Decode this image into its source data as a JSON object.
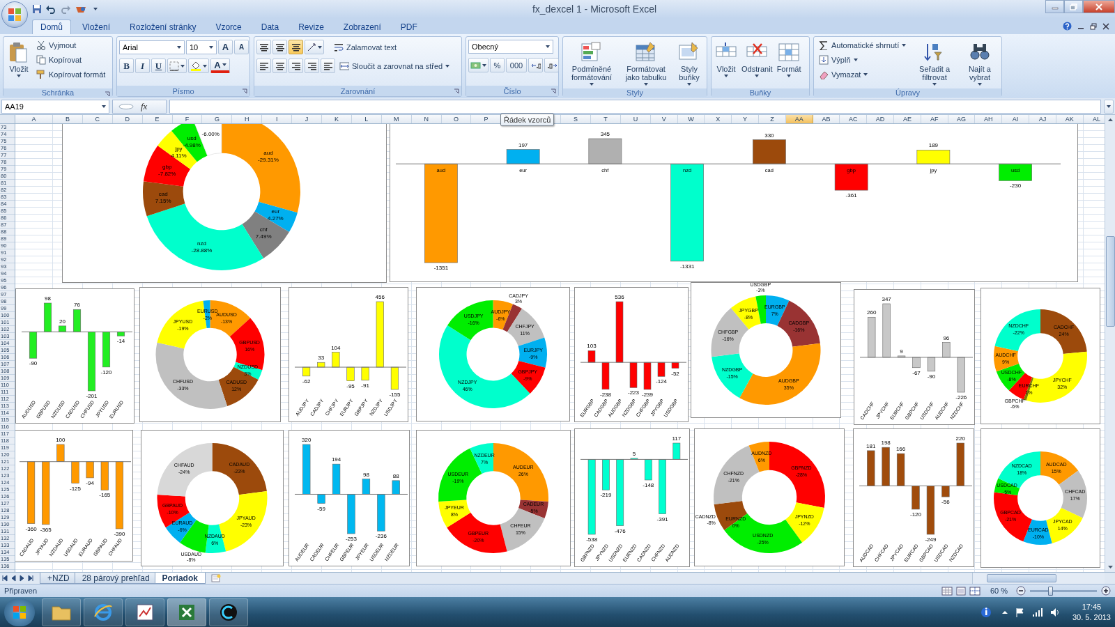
{
  "window": {
    "title": "fx_dexcel 1 - Microsoft Excel"
  },
  "ribbon_tabs": [
    {
      "label": "Domů",
      "selected": true
    },
    {
      "label": "Vložení",
      "selected": false
    },
    {
      "label": "Rozložení stránky",
      "selected": false
    },
    {
      "label": "Vzorce",
      "selected": false
    },
    {
      "label": "Data",
      "selected": false
    },
    {
      "label": "Revize",
      "selected": false
    },
    {
      "label": "Zobrazení",
      "selected": false
    },
    {
      "label": "PDF",
      "selected": false
    }
  ],
  "ribbon": {
    "clipboard": {
      "label": "Schránka",
      "paste": "Vložit",
      "cut": "Vyjmout",
      "copy": "Kopírovat",
      "format_painter": "Kopírovat formát"
    },
    "font": {
      "label": "Písmo",
      "font_name": "Arial",
      "font_size": "10",
      "grow_font": "A",
      "shrink_font": "A",
      "bold": "B",
      "italic": "I",
      "underline": "U",
      "font_color": "A"
    },
    "alignment": {
      "label": "Zarovnání",
      "wrap_text": "Zalamovat text",
      "merge_center": "Sloučit a zarovnat na střed"
    },
    "number": {
      "label": "Číslo",
      "format": "Obecný",
      "percent": "%",
      "thousands": "000"
    },
    "styles": {
      "label": "Styly",
      "buttons": [
        "Podmíněné formátování",
        "Formátovat jako tabulku",
        "Styly buňky"
      ]
    },
    "cells": {
      "label": "Buňky",
      "buttons": [
        "Vložit",
        "Odstranit",
        "Formát"
      ]
    },
    "editing": {
      "label": "Úpravy",
      "autosum": "Automatické shrnutí",
      "fill": "Výplň",
      "clear": "Vymazat",
      "buttons": [
        "Seřadit a filtrovat",
        "Najít a vybrat"
      ]
    }
  },
  "formula_bar": {
    "name_box": "AA19",
    "fx": "fx",
    "tooltip": "Řádek vzorců"
  },
  "columns": [
    {
      "label": "A",
      "selected": false
    },
    {
      "label": "B",
      "selected": false
    },
    {
      "label": "C",
      "selected": false
    },
    {
      "label": "D",
      "selected": false
    },
    {
      "label": "E",
      "selected": false
    },
    {
      "label": "F",
      "selected": false
    },
    {
      "label": "G",
      "selected": false
    },
    {
      "label": "H",
      "selected": false
    },
    {
      "label": "I",
      "selected": false
    },
    {
      "label": "J",
      "selected": false
    },
    {
      "label": "K",
      "selected": false
    },
    {
      "label": "L",
      "selected": false
    },
    {
      "label": "M",
      "selected": false
    },
    {
      "label": "N",
      "selected": false
    },
    {
      "label": "O",
      "selected": false
    },
    {
      "label": "P",
      "selected": false
    },
    {
      "label": "S",
      "selected": false
    },
    {
      "label": "T",
      "selected": false
    },
    {
      "label": "U",
      "selected": false
    },
    {
      "label": "V",
      "selected": false
    },
    {
      "label": "W",
      "selected": false
    },
    {
      "label": "X",
      "selected": false
    },
    {
      "label": "Y",
      "selected": false
    },
    {
      "label": "Z",
      "selected": false
    },
    {
      "label": "AA",
      "selected": true
    },
    {
      "label": "AB",
      "selected": false
    },
    {
      "label": "AC",
      "selected": false
    },
    {
      "label": "AD",
      "selected": false
    },
    {
      "label": "AE",
      "selected": false
    },
    {
      "label": "AF",
      "selected": false
    },
    {
      "label": "AG",
      "selected": false
    },
    {
      "label": "AH",
      "selected": false
    },
    {
      "label": "AI",
      "selected": false
    },
    {
      "label": "AJ",
      "selected": false
    },
    {
      "label": "AK",
      "selected": false
    },
    {
      "label": "AL",
      "selected": false
    }
  ],
  "rows": [
    "73",
    "74",
    "75",
    "76",
    "77",
    "78",
    "79",
    "80",
    "81",
    "82",
    "83",
    "84",
    "85",
    "86",
    "87",
    "88",
    "89",
    "90",
    "91",
    "92",
    "93",
    "94",
    "95",
    "96",
    "97",
    "98",
    "99",
    "100",
    "101",
    "102",
    "103",
    "104",
    "105",
    "106",
    "107",
    "108",
    "109",
    "110",
    "111",
    "112",
    "113",
    "114",
    "115",
    "116",
    "117",
    "118",
    "119",
    "120",
    "121",
    "122",
    "123",
    "124",
    "125",
    "126",
    "127",
    "128",
    "129",
    "130",
    "131",
    "132",
    "133",
    "134",
    "135",
    "136"
  ],
  "charts": [
    {
      "chart_data": {
        "type": "donut",
        "categories": [
          "aud",
          "eur",
          "chf",
          "nzd",
          "cad",
          "gbp",
          "jpy",
          "usd",
          null
        ],
        "series": [
          {
            "values": [
              29.31,
              4.27,
              7.49,
              28.88,
              7.15,
              7.82,
              4.11,
              4.98,
              6.0
            ],
            "colors": [
              "#ff9900",
              "#00b0f0",
              "#808080",
              "#00ffcc",
              "#9c4a0c",
              "#ff0000",
              "#ffff00",
              "#00ee00",
              "#ffffff"
            ]
          }
        ],
        "value_labels": [
          "-29.31%",
          "4.27%",
          "7.49%",
          "-28.88%",
          "7.15%",
          "-7.82%",
          "4.11%",
          "-4.98%",
          "-6.00%"
        ]
      }
    },
    {
      "chart_data": {
        "type": "bar",
        "categories": [
          "aud",
          "eur",
          "chf",
          "nzd",
          "cad",
          "gbp",
          "jpy",
          "usd"
        ],
        "series": [
          {
            "values": [
              -1351,
              197,
              345,
              -1331,
              330,
              -361,
              189,
              -230
            ],
            "colors": [
              "#ff9900",
              "#00b0f0",
              "#b0b0b0",
              "#00ffcc",
              "#9c4a0c",
              "#ff0000",
              "#ffff00",
              "#00ee00"
            ]
          }
        ],
        "data_labels": true
      }
    },
    {
      "chart_data": {
        "type": "bar",
        "categories": [
          "AUDUSD",
          "GBPUSD",
          "NZDUSD",
          "CADUSD",
          "CHFUSD",
          "JPYUSD",
          "EURUSD"
        ],
        "series": [
          {
            "color": "#22ee22",
            "values": [
              -90,
              98,
              20,
              76,
              -201,
              -120,
              -14
            ]
          }
        ],
        "data_labels": true
      }
    },
    {
      "chart_data": {
        "type": "donut",
        "categories": [
          "AUDUSD",
          "GBPUSD",
          "NZDUSD",
          "CADUSD",
          "CHFUSD",
          "JPYUSD",
          "EURUSD"
        ],
        "series": [
          {
            "values": [
              13,
              16,
              3,
              12,
              33,
              19,
              2
            ],
            "colors": [
              "#ff9900",
              "#ff0000",
              "#00ffcc",
              "#9c4a0c",
              "#c0c0c0",
              "#ffff00",
              "#00b0f0"
            ]
          }
        ],
        "value_labels": [
          "-13%",
          "16%",
          "3%",
          "12%",
          "-33%",
          "-19%",
          "-2%"
        ]
      }
    },
    {
      "chart_data": {
        "type": "bar",
        "categories": [
          "AUDJPY",
          "CADJPY",
          "CHFJPY",
          "EURJPY",
          "GBPJPY",
          "NZDJPY",
          "USDJPY"
        ],
        "series": [
          {
            "color": "#ffff00",
            "values": [
              -62,
              33,
              104,
              -95,
              -91,
              456,
              -155
            ]
          }
        ],
        "data_labels": true
      }
    },
    {
      "chart_data": {
        "type": "donut",
        "categories": [
          "AUDJPY",
          "CADJPY",
          "CHFJPY",
          "EURJPY",
          "GBPJPY",
          "NZDJPY",
          "USDJPY"
        ],
        "series": [
          {
            "values": [
              6,
              3,
              11,
              9,
              9,
              46,
              16
            ],
            "colors": [
              "#ff9900",
              "#993333",
              "#c0c0c0",
              "#00b0f0",
              "#ff0000",
              "#00ffcc",
              "#00ee00"
            ]
          }
        ],
        "value_labels": [
          "-6%",
          "3%",
          "11%",
          "-9%",
          "-9%",
          "46%",
          "-16%"
        ]
      }
    },
    {
      "chart_data": {
        "type": "bar",
        "categories": [
          "EURGBP",
          "CADGBP",
          "AUDGBP",
          "NZDGBP",
          "CHFGBP",
          "JPYGBP",
          "USDGBP"
        ],
        "series": [
          {
            "color": "#ff0000",
            "values": [
              103,
              -238,
              536,
              -223,
              -239,
              -124,
              -52
            ]
          }
        ],
        "data_labels": true
      }
    },
    {
      "chart_data": {
        "type": "donut",
        "categories": [
          "EURGBP",
          "CADGBP",
          "AUDGBP",
          "NZDGBP",
          "CHFGBP",
          "JPYGBP",
          "USDGBP"
        ],
        "series": [
          {
            "values": [
              7,
              16,
              35,
              15,
              16,
              8,
              3
            ],
            "colors": [
              "#00b0f0",
              "#993333",
              "#ff9900",
              "#00ffcc",
              "#c0c0c0",
              "#ffff00",
              "#00ee00"
            ]
          }
        ],
        "value_labels": [
          "7%",
          "-16%",
          "35%",
          "-15%",
          "-16%",
          "-8%",
          "-3%"
        ]
      }
    },
    {
      "chart_data": {
        "type": "bar",
        "categories": [
          "CADCHF",
          "JPYCHF",
          "EURCHF",
          "GBPCHF",
          "USDCHF",
          "AUDCHF",
          "NZDCHF"
        ],
        "series": [
          {
            "color": "#c8c8c8",
            "values": [
              260,
              347,
              9,
              -67,
              -90,
              96,
              -226
            ]
          }
        ],
        "data_labels": true
      }
    },
    {
      "chart_data": {
        "type": "donut",
        "categories": [
          "CADCHF",
          "JPYCHF",
          "EURCHF",
          "GBPCHF",
          "USDCHF",
          "AUDCHF",
          "NZDCHF"
        ],
        "series": [
          {
            "values": [
              24,
              32,
              1,
              6,
              8,
              9,
              22
            ],
            "colors": [
              "#9c4a0c",
              "#ffff00",
              "#808000",
              "#ff0000",
              "#00ee00",
              "#ff9900",
              "#00ffcc"
            ]
          }
        ],
        "value_labels": [
          "24%",
          "32%",
          "1%",
          "-6%",
          "-8%",
          "9%",
          "-22%"
        ]
      }
    },
    {
      "chart_data": {
        "type": "bar",
        "categories": [
          "CADAUD",
          "JPYAUD",
          "NZDAUD",
          "USDAUD",
          "EURAUD",
          "GBPAUD",
          "CHFAUD"
        ],
        "series": [
          {
            "color": "#ff9900",
            "values": [
              -360,
              -365,
              100,
              -125,
              -94,
              -165,
              -390
            ]
          }
        ],
        "data_labels": true
      }
    },
    {
      "chart_data": {
        "type": "donut",
        "categories": [
          "CADAUD",
          "JPYAUD",
          "NZDAUD",
          "USDAUD",
          "EURAUD",
          "GBPAUD",
          "CHFAUD"
        ],
        "series": [
          {
            "values": [
              23,
              23,
              6,
              8,
              6,
              10,
              24
            ],
            "colors": [
              "#9c4a0c",
              "#ffff00",
              "#00ffcc",
              "#00ee00",
              "#00b0f0",
              "#ff0000",
              "#d8d8d8"
            ]
          }
        ],
        "value_labels": [
          "-23%",
          "-23%",
          "6%",
          "-8%",
          "-6%",
          "-10%",
          "-24%"
        ]
      }
    },
    {
      "chart_data": {
        "type": "bar",
        "categories": [
          "AUDEUR",
          "CADEUR",
          "CHFEUR",
          "GBPEUR",
          "JPYEUR",
          "USDEUR",
          "NZDEUR"
        ],
        "series": [
          {
            "color": "#00b8f0",
            "values": [
              320,
              -59,
              194,
              -253,
              98,
              -236,
              88
            ]
          }
        ],
        "data_labels": true
      }
    },
    {
      "chart_data": {
        "type": "donut",
        "categories": [
          "AUDEUR",
          "CADEUR",
          "CHFEUR",
          "GBPEUR",
          "JPYEUR",
          "USDEUR",
          "NZDEUR"
        ],
        "series": [
          {
            "values": [
              26,
              5,
              15,
              20,
              8,
              19,
              7
            ],
            "colors": [
              "#ff9900",
              "#993333",
              "#c0c0c0",
              "#ff0000",
              "#ffff00",
              "#00ee00",
              "#00ffcc"
            ]
          }
        ],
        "value_labels": [
          "26%",
          "-5%",
          "15%",
          "-20%",
          "8%",
          "-19%",
          "7%"
        ]
      }
    },
    {
      "chart_data": {
        "type": "bar",
        "categories": [
          "GBPNZD",
          "JPYNZD",
          "USDNZD",
          "EURNZD",
          "CADNZD",
          "CHFNZD",
          "AUDNZD"
        ],
        "series": [
          {
            "color": "#00ffd0",
            "values": [
              -538,
              -219,
              -476,
              5,
              -148,
              -391,
              117
            ]
          }
        ],
        "data_labels": true
      }
    },
    {
      "chart_data": {
        "type": "donut",
        "categories": [
          "GBPNZD",
          "JPYNZD",
          "USDNZD",
          "EURNZD",
          "CADNZD",
          "CHFNZD",
          "AUDNZD"
        ],
        "series": [
          {
            "values": [
              28,
              12,
              25,
              0,
              8,
              21,
              6
            ],
            "colors": [
              "#ff0000",
              "#ffff00",
              "#00ee00",
              "#00b0f0",
              "#9c4a0c",
              "#c0c0c0",
              "#ff9900"
            ]
          }
        ],
        "value_labels": [
          "-28%",
          "-12%",
          "-25%",
          "0%",
          "-8%",
          "-21%",
          "6%"
        ]
      }
    },
    {
      "chart_data": {
        "type": "bar",
        "categories": [
          "AUDCAD",
          "CHFCAD",
          "JPYCAD",
          "EURCAD",
          "GBPCAD",
          "USDCAD",
          "NZDCAD"
        ],
        "series": [
          {
            "color": "#a04c0c",
            "values": [
              181,
              198,
              166,
              -120,
              -249,
              -56,
              220
            ]
          }
        ],
        "data_labels": true
      }
    },
    {
      "chart_data": {
        "type": "donut",
        "categories": [
          "AUDCAD",
          "CHFCAD",
          "JPYCAD",
          "EURCAD",
          "GBPCAD",
          "USDCAD",
          "NZDCAD"
        ],
        "series": [
          {
            "values": [
              15,
              17,
              14,
              10,
              21,
              5,
              18
            ],
            "colors": [
              "#ff9900",
              "#c0c0c0",
              "#ffff00",
              "#00b0f0",
              "#ff0000",
              "#00ee00",
              "#00ffcc"
            ]
          }
        ],
        "value_labels": [
          "15%",
          "17%",
          "14%",
          "-10%",
          "-21%",
          "-5%",
          "18%"
        ]
      }
    }
  ],
  "sheet_tabs": [
    {
      "label": "+NZD",
      "selected": false
    },
    {
      "label": "28 párový prehľad",
      "selected": false
    },
    {
      "label": "Poriadok",
      "selected": true
    }
  ],
  "status_bar": {
    "text": "Připraven",
    "zoom": "60 %",
    "zoom_slider": {
      "level": 0.3
    }
  },
  "taskbar": {
    "time": "17:45",
    "date": "30. 5. 2013"
  }
}
